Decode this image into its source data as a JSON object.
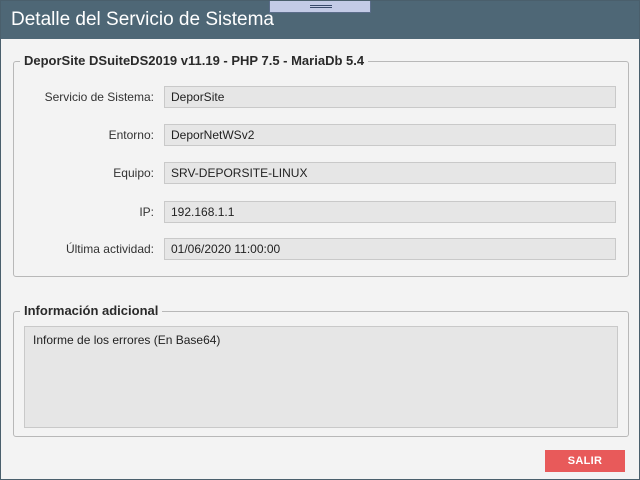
{
  "window": {
    "title": "Detalle del Servicio de Sistema"
  },
  "main_group": {
    "legend": "DeporSite DSuiteDS2019 v11.19 - PHP 7.5 - MariaDb 5.4",
    "fields": [
      {
        "label": "Servicio de Sistema:",
        "value": "DeporSite"
      },
      {
        "label": "Entorno:",
        "value": "DeporNetWSv2"
      },
      {
        "label": "Equipo:",
        "value": "SRV-DEPORSITE-LINUX"
      },
      {
        "label": "IP:",
        "value": "192.168.1.1"
      },
      {
        "label": "Última actividad:",
        "value": "01/06/2020 11:00:00"
      }
    ]
  },
  "extra_group": {
    "legend": "Información adicional",
    "text": "Informe de los errores (En Base64)"
  },
  "actions": {
    "exit_label": "SALIR"
  },
  "colors": {
    "titlebar": "#4e6776",
    "exit_button": "#e85a5a",
    "field_background": "#e6e6e6"
  }
}
